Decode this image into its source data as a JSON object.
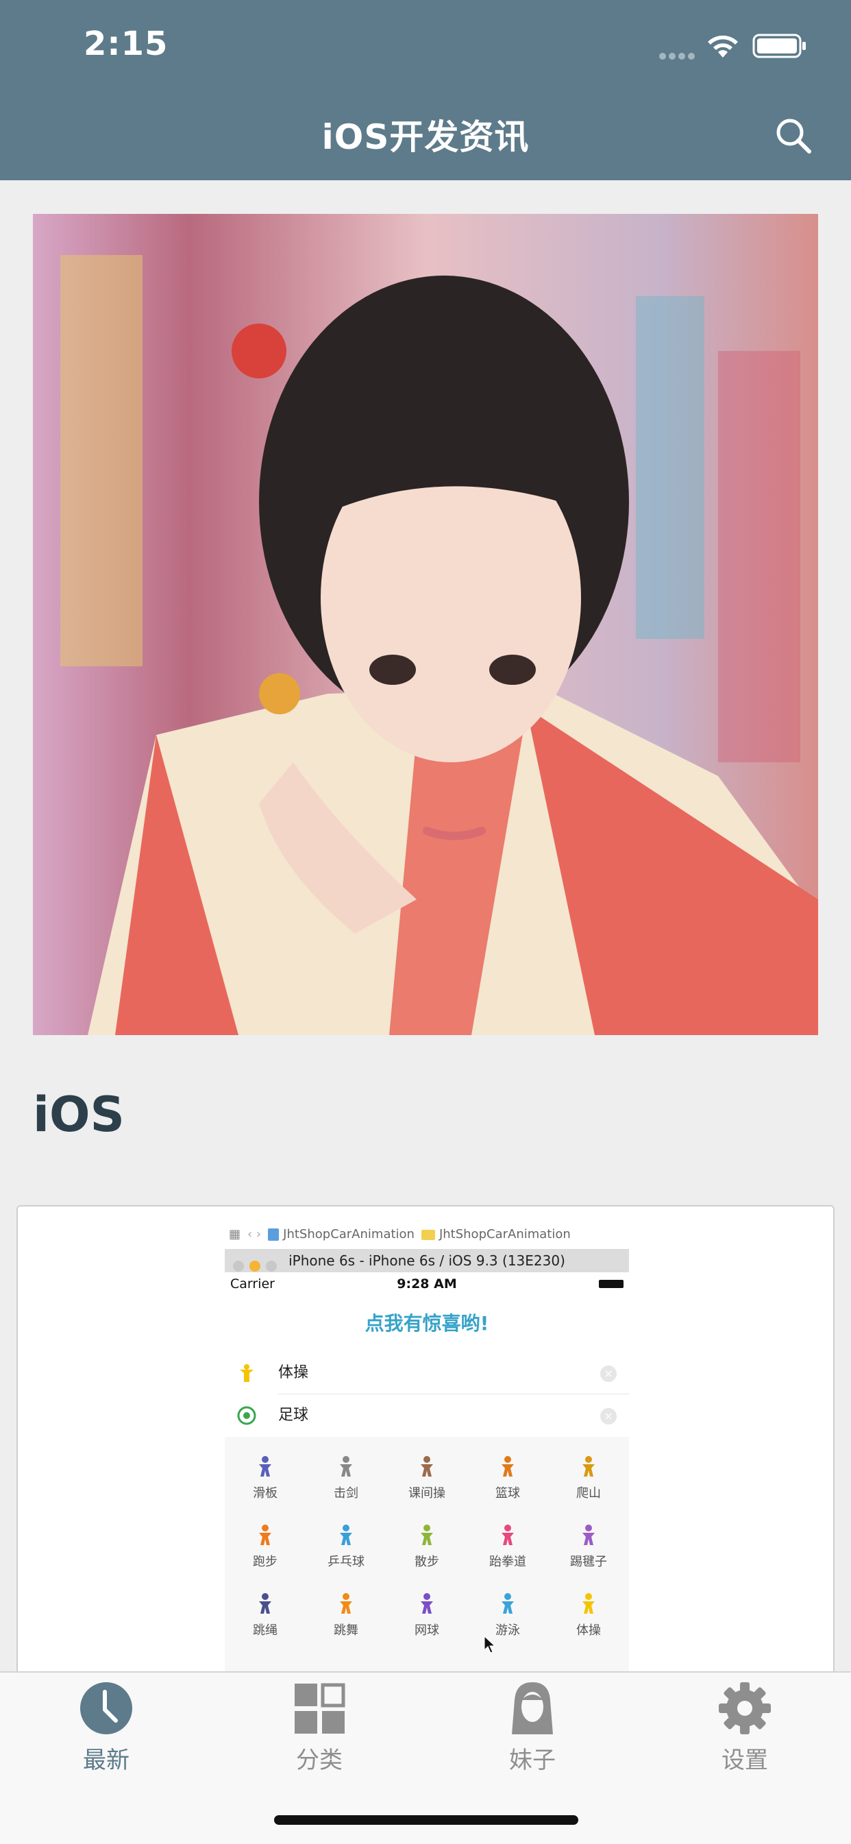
{
  "status_bar": {
    "time": "2:15"
  },
  "nav": {
    "title": "iOS开发资讯"
  },
  "hero": {
    "image_alt": ""
  },
  "section": {
    "title": "iOS"
  },
  "card_preview": {
    "crumb_1": "JhtShopCarAnimation",
    "crumb_2": "JhtShopCarAnimation",
    "window_title": "iPhone 6s - iPhone 6s / iOS 9.3 (13E230)",
    "carrier": "Carrier",
    "time": "9:28 AM",
    "header": "点我有惊喜哟!",
    "rows": [
      {
        "label": "体操",
        "icon": "gymnastics-icon",
        "color": "#f5c400"
      },
      {
        "label": "足球",
        "icon": "soccer-icon",
        "color": "#3aa64f"
      }
    ],
    "grid": [
      {
        "label": "滑板",
        "color": "#5a5fb8"
      },
      {
        "label": "击剑",
        "color": "#888888"
      },
      {
        "label": "课间操",
        "color": "#9b6b4a"
      },
      {
        "label": "篮球",
        "color": "#e07a1b"
      },
      {
        "label": "爬山",
        "color": "#d99a12"
      },
      {
        "label": "跑步",
        "color": "#f07a1c"
      },
      {
        "label": "乒乓球",
        "color": "#3a9fd8"
      },
      {
        "label": "散步",
        "color": "#8fb43c"
      },
      {
        "label": "跆拳道",
        "color": "#e8487c"
      },
      {
        "label": "踢毽子",
        "color": "#9b5cc4"
      },
      {
        "label": "跳绳",
        "color": "#4a4f8f"
      },
      {
        "label": "跳舞",
        "color": "#f28a14"
      },
      {
        "label": "网球",
        "color": "#7b4fc6"
      },
      {
        "label": "游泳",
        "color": "#3aa3d8"
      },
      {
        "label": "体操",
        "color": "#f5c400"
      }
    ]
  },
  "tabs": [
    {
      "label": "最新",
      "icon": "clock-icon",
      "active": true
    },
    {
      "label": "分类",
      "icon": "grid-icon",
      "active": false
    },
    {
      "label": "妹子",
      "icon": "girl-icon",
      "active": false
    },
    {
      "label": "设置",
      "icon": "gear-icon",
      "active": false
    }
  ],
  "colors": {
    "nav_bg": "#5d7b8a",
    "accent": "#5d7b8a",
    "inactive": "#8e8e8e"
  }
}
